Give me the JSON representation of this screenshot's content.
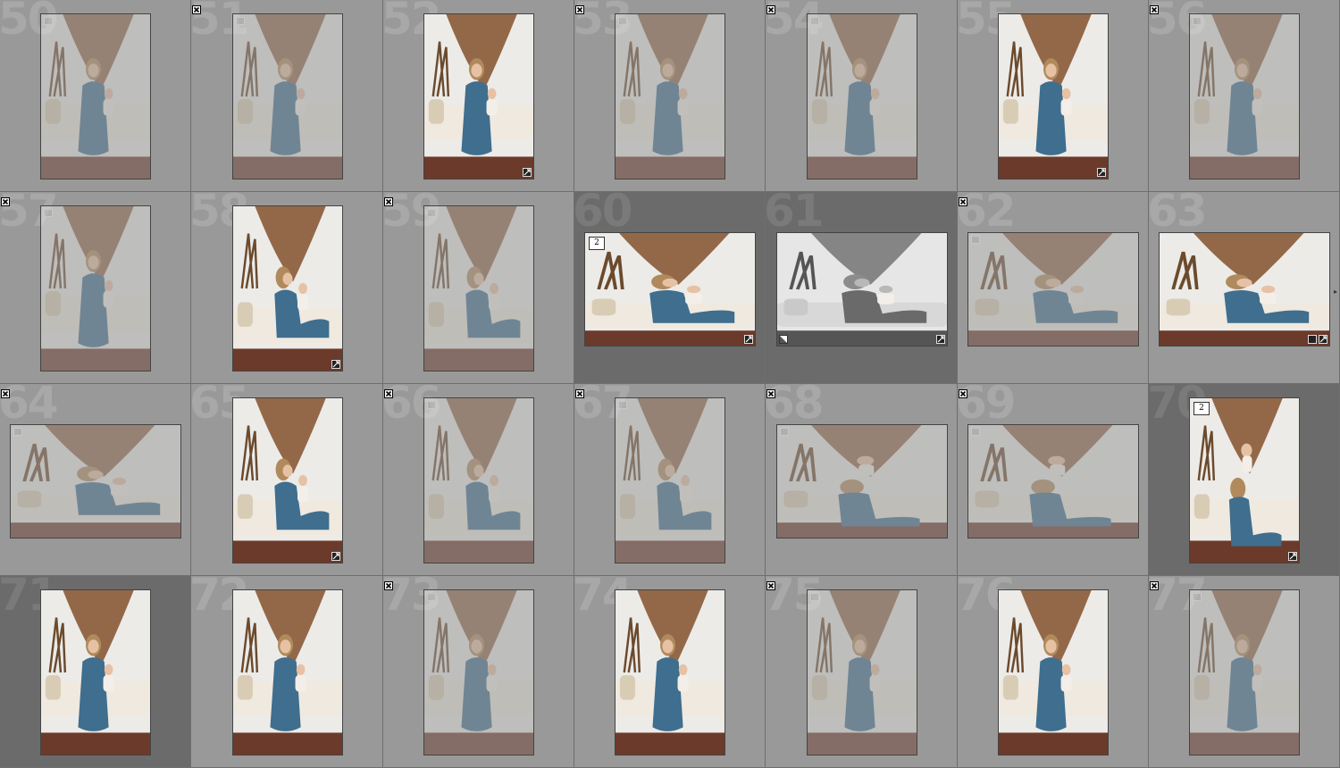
{
  "cells": [
    {
      "label": "50",
      "flag": false,
      "selected": false,
      "orient": "p",
      "pose": "sit",
      "faded": true,
      "badge": false,
      "meta": true,
      "stack": ""
    },
    {
      "label": "51",
      "flag": true,
      "selected": false,
      "orient": "p",
      "pose": "sit",
      "faded": true,
      "badge": false,
      "meta": true,
      "stack": ""
    },
    {
      "label": "52",
      "flag": false,
      "selected": false,
      "orient": "p",
      "pose": "sit",
      "faded": false,
      "badge": true,
      "meta": false,
      "stack": ""
    },
    {
      "label": "53",
      "flag": true,
      "selected": false,
      "orient": "p",
      "pose": "sit",
      "faded": true,
      "badge": false,
      "meta": true,
      "stack": ""
    },
    {
      "label": "54",
      "flag": true,
      "selected": false,
      "orient": "p",
      "pose": "sit",
      "faded": true,
      "badge": false,
      "meta": true,
      "stack": ""
    },
    {
      "label": "55",
      "flag": false,
      "selected": false,
      "orient": "p",
      "pose": "sit",
      "faded": false,
      "badge": true,
      "meta": false,
      "stack": ""
    },
    {
      "label": "56",
      "flag": true,
      "selected": false,
      "orient": "p",
      "pose": "sit",
      "faded": true,
      "badge": false,
      "meta": true,
      "stack": ""
    },
    {
      "label": "57",
      "flag": true,
      "selected": false,
      "orient": "p",
      "pose": "sit",
      "faded": true,
      "badge": false,
      "meta": true,
      "stack": ""
    },
    {
      "label": "58",
      "flag": false,
      "selected": false,
      "orient": "p",
      "pose": "couch",
      "faded": false,
      "badge": true,
      "meta": false,
      "stack": ""
    },
    {
      "label": "59",
      "flag": true,
      "selected": false,
      "orient": "p",
      "pose": "couch",
      "faded": true,
      "badge": false,
      "meta": true,
      "stack": ""
    },
    {
      "label": "60",
      "flag": false,
      "selected": true,
      "orient": "l",
      "pose": "couch",
      "faded": false,
      "badge": true,
      "meta": false,
      "stack": "2"
    },
    {
      "label": "61",
      "flag": false,
      "selected": true,
      "orient": "l",
      "pose": "bw",
      "faded": false,
      "badge": true,
      "meta": false,
      "stack": ""
    },
    {
      "label": "62",
      "flag": true,
      "selected": false,
      "orient": "l",
      "pose": "couch",
      "faded": true,
      "badge": false,
      "meta": true,
      "stack": ""
    },
    {
      "label": "63",
      "flag": false,
      "selected": false,
      "orient": "l",
      "pose": "couch",
      "faded": false,
      "badge": true,
      "meta": false,
      "stack": ""
    },
    {
      "label": "64",
      "flag": true,
      "selected": false,
      "orient": "l",
      "pose": "couch",
      "faded": true,
      "badge": false,
      "meta": true,
      "stack": ""
    },
    {
      "label": "65",
      "flag": false,
      "selected": false,
      "orient": "p",
      "pose": "couch",
      "faded": false,
      "badge": true,
      "meta": false,
      "stack": ""
    },
    {
      "label": "66",
      "flag": true,
      "selected": false,
      "orient": "p",
      "pose": "couch",
      "faded": true,
      "badge": false,
      "meta": true,
      "stack": ""
    },
    {
      "label": "67",
      "flag": true,
      "selected": false,
      "orient": "p",
      "pose": "couch",
      "faded": true,
      "badge": false,
      "meta": true,
      "stack": ""
    },
    {
      "label": "68",
      "flag": true,
      "selected": false,
      "orient": "l",
      "pose": "lift",
      "faded": true,
      "badge": false,
      "meta": true,
      "stack": ""
    },
    {
      "label": "69",
      "flag": true,
      "selected": false,
      "orient": "l",
      "pose": "lift",
      "faded": true,
      "badge": false,
      "meta": true,
      "stack": ""
    },
    {
      "label": "70",
      "flag": false,
      "selected": true,
      "orient": "p",
      "pose": "lift",
      "faded": false,
      "badge": true,
      "meta": false,
      "stack": "2"
    },
    {
      "label": "71",
      "flag": false,
      "selected": true,
      "orient": "p",
      "pose": "sit",
      "faded": false,
      "badge": false,
      "meta": false,
      "stack": ""
    },
    {
      "label": "72",
      "flag": false,
      "selected": false,
      "orient": "p",
      "pose": "sit",
      "faded": false,
      "badge": false,
      "meta": false,
      "stack": ""
    },
    {
      "label": "73",
      "flag": true,
      "selected": false,
      "orient": "p",
      "pose": "sit",
      "faded": true,
      "badge": false,
      "meta": true,
      "stack": ""
    },
    {
      "label": "74",
      "flag": false,
      "selected": false,
      "orient": "p",
      "pose": "sit",
      "faded": false,
      "badge": false,
      "meta": false,
      "stack": ""
    },
    {
      "label": "75",
      "flag": true,
      "selected": false,
      "orient": "p",
      "pose": "sit",
      "faded": true,
      "badge": false,
      "meta": true,
      "stack": ""
    },
    {
      "label": "76",
      "flag": false,
      "selected": false,
      "orient": "p",
      "pose": "sit",
      "faded": false,
      "badge": false,
      "meta": false,
      "stack": ""
    },
    {
      "label": "77",
      "flag": true,
      "selected": false,
      "orient": "p",
      "pose": "sit",
      "faded": true,
      "badge": false,
      "meta": true,
      "stack": ""
    }
  ],
  "icons": {
    "reject_flag": "reject-flag-icon",
    "metadata": "metadata-badge-icon",
    "edited": "develop-adjusted-icon",
    "expand": "expand-arrow-icon"
  },
  "colors": {
    "cell_bg": "#999999",
    "cell_selected_bg": "#6b6b6b",
    "cell_number": "#a8a8a8"
  }
}
